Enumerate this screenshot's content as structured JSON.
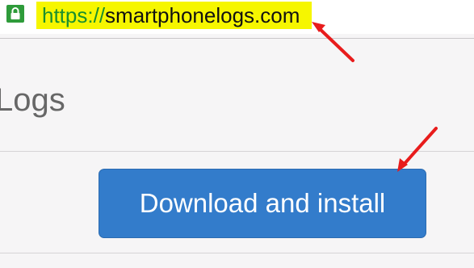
{
  "browser": {
    "url_scheme": "https://",
    "url_host": "smartphonelogs.com",
    "lock_icon": "lock-icon",
    "highlight_color": "#f6f600",
    "secure_color": "#2e9b3a"
  },
  "page": {
    "title": "Logs"
  },
  "download": {
    "label": "Download and install",
    "color": "#337ccb"
  },
  "annotations": {
    "arrow_color": "#e81c1c",
    "icon": "red-arrow-icon"
  }
}
